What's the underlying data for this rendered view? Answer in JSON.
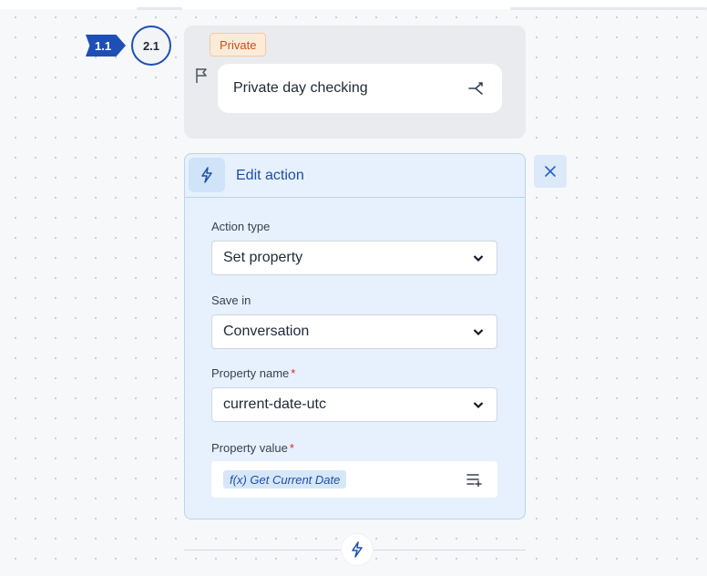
{
  "node_badges": {
    "parent": "1.1",
    "current": "2.1"
  },
  "step": {
    "tag": "Private",
    "title": "Private day checking",
    "flag_icon": "flag-icon",
    "branch_icon": "branch-icon"
  },
  "action": {
    "header_title": "Edit action",
    "fields": {
      "action_type": {
        "label": "Action type",
        "value": "Set property"
      },
      "save_in": {
        "label": "Save in",
        "value": "Conversation"
      },
      "property_name": {
        "label": "Property name",
        "value": "current-date-utc",
        "required_mark": "*"
      },
      "property_value": {
        "label": "Property value",
        "value": "f(x) Get Current Date",
        "required_mark": "*"
      }
    }
  },
  "colors": {
    "accent": "#1e4fb6",
    "card_bg": "#e6f1fd",
    "tag_text": "#c4501a",
    "required": "#dc2626"
  }
}
